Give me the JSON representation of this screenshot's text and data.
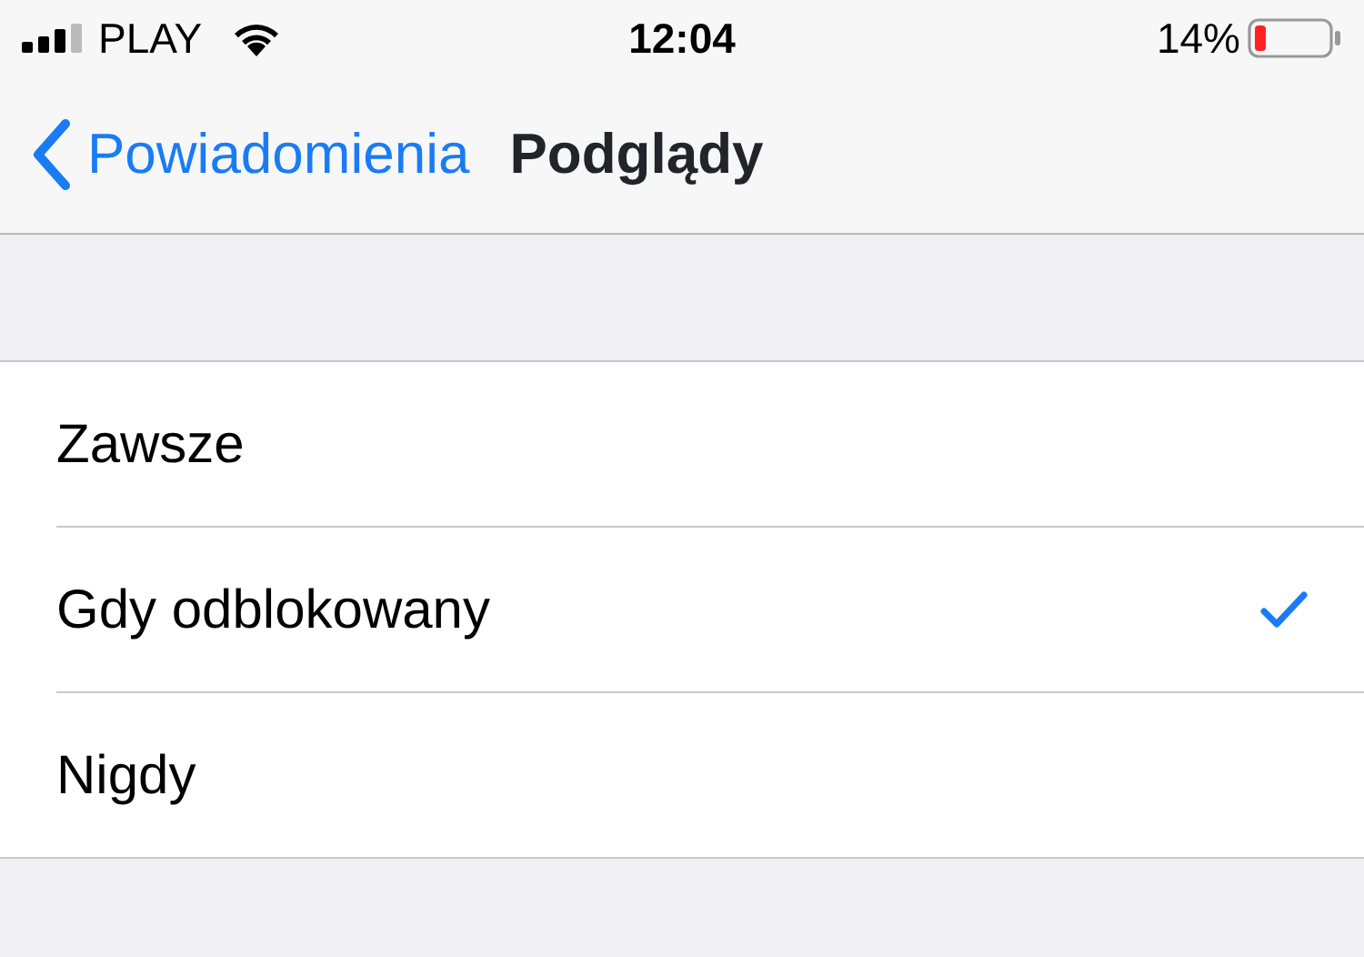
{
  "status_bar": {
    "carrier": "PLAY",
    "time": "12:04",
    "battery": "14%"
  },
  "nav_bar": {
    "back_label": "Powiadomienia",
    "title": "Podglądy"
  },
  "options": [
    {
      "label": "Zawsze",
      "selected": false
    },
    {
      "label": "Gdy odblokowany",
      "selected": true
    },
    {
      "label": "Nigdy",
      "selected": false
    }
  ]
}
